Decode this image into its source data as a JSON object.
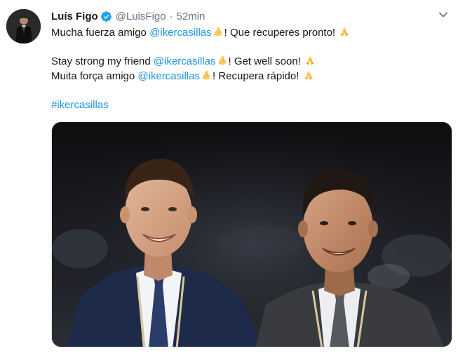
{
  "tweet": {
    "display_name": "Luís Figo",
    "handle": "@LuisFigo",
    "separator": "·",
    "time": "52min",
    "body": {
      "line1": {
        "before": "Mucha fuerza amigo ",
        "mention": "@ikercasillas",
        "after": "! Que recuperes pronto! "
      },
      "line2": {
        "before": "Stay strong my friend ",
        "mention": "@ikercasillas",
        "after": "! Get well soon! "
      },
      "line3": {
        "before": "Muita força amigo ",
        "mention": "@ikercasillas",
        "after": "! Recupera rápido! "
      },
      "hashtag": "#ikercasillas"
    },
    "icons": {
      "verified": "verified-badge-icon",
      "caret": "chevron-down-icon",
      "flexed_biceps": "flexed-biceps-emoji",
      "folded_hands": "folded-hands-emoji"
    },
    "colors": {
      "link": "#1b95e0",
      "secondary_text": "#657786",
      "verified": "#1da1f2"
    }
  }
}
